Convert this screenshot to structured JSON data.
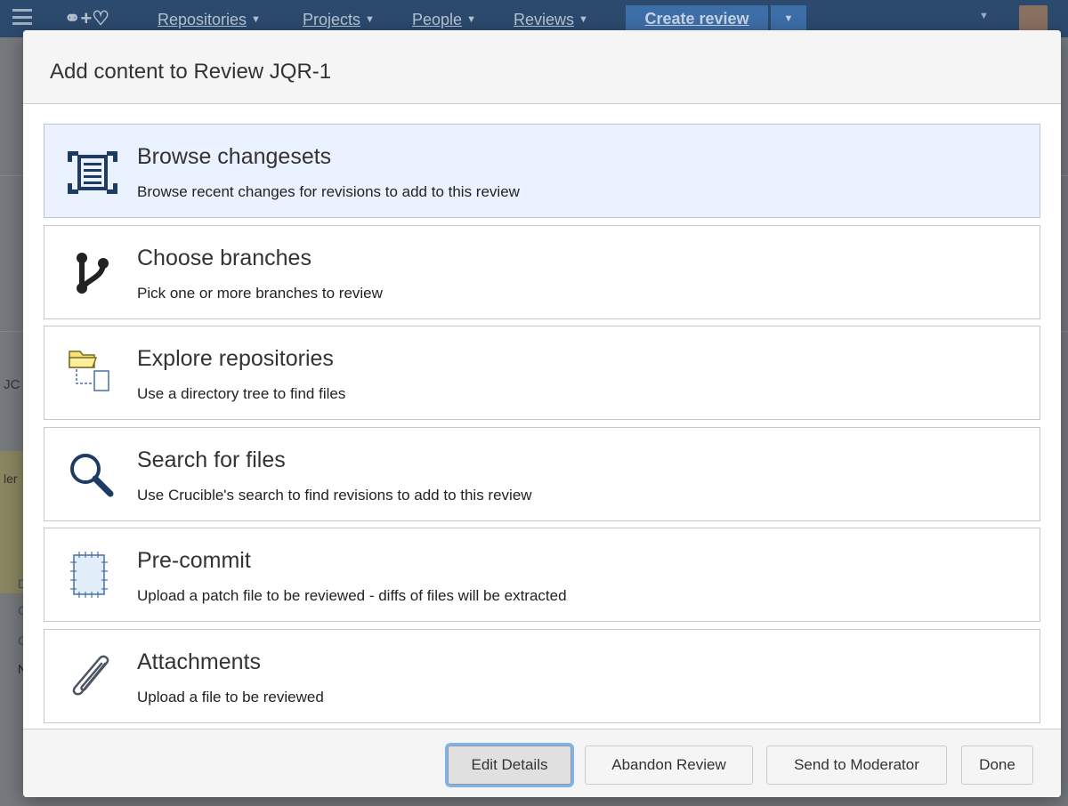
{
  "nav": {
    "repositories": "Repositories",
    "projects": "Projects",
    "people": "People",
    "reviews": "Reviews",
    "create_review": "Create review"
  },
  "background": {
    "side_fragments": [
      "JC",
      "ler"
    ],
    "side_links": [
      "D",
      "C",
      "C",
      "N"
    ]
  },
  "modal": {
    "title": "Add content to Review JQR-1",
    "options": [
      {
        "title": "Browse changesets",
        "description": "Browse recent changes for revisions to add to this review",
        "icon": "changeset-list-icon",
        "selected": true
      },
      {
        "title": "Choose branches",
        "description": "Pick one or more branches to review",
        "icon": "branch-icon",
        "selected": false
      },
      {
        "title": "Explore repositories",
        "description": "Use a directory tree to find files",
        "icon": "folder-tree-icon",
        "selected": false
      },
      {
        "title": "Search for files",
        "description": "Use Crucible's search to find revisions to add to this review",
        "icon": "magnifier-icon",
        "selected": false
      },
      {
        "title": "Pre-commit",
        "description": "Upload a patch file to be reviewed - diffs of files will be extracted",
        "icon": "patch-file-icon",
        "selected": false
      },
      {
        "title": "Attachments",
        "description": "Upload a file to be reviewed",
        "icon": "paperclip-icon",
        "selected": false
      }
    ],
    "buttons": {
      "edit_details": "Edit Details",
      "abandon_review": "Abandon Review",
      "send_to_moderator": "Send to Moderator",
      "done": "Done"
    }
  },
  "colors": {
    "topbar": "#2c4a6e",
    "selected_option_bg": "#ebf2ff",
    "icon_navy": "#1d3b63",
    "focus_ring": "#7fb4ea"
  }
}
